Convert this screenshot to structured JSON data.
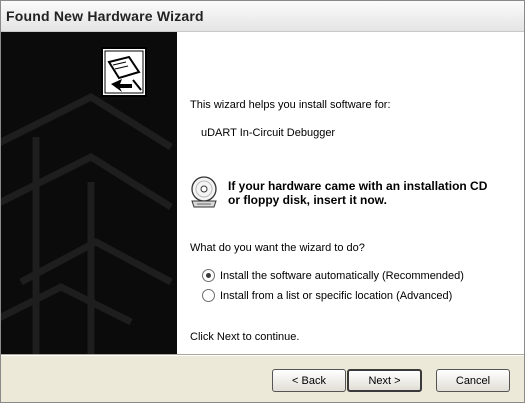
{
  "window": {
    "title": "Found New Hardware Wizard"
  },
  "main": {
    "intro": "This wizard helps you install software for:",
    "device_name": "uDART In-Circuit Debugger",
    "cd_notice_line1": "If your hardware came with an installation CD",
    "cd_notice_line2": "or floppy disk, insert it now.",
    "question": "What do you want the wizard to do?",
    "options": [
      {
        "label": "Install the software automatically (Recommended)",
        "selected": true
      },
      {
        "label": "Install from a list or specific location (Advanced)",
        "selected": false
      }
    ],
    "footer": "Click Next to continue."
  },
  "buttons": {
    "back": "< Back",
    "next": "Next >",
    "cancel": "Cancel"
  },
  "icons": {
    "sidebar": "hardware-installer-icon",
    "disc": "cd-disc-icon"
  }
}
